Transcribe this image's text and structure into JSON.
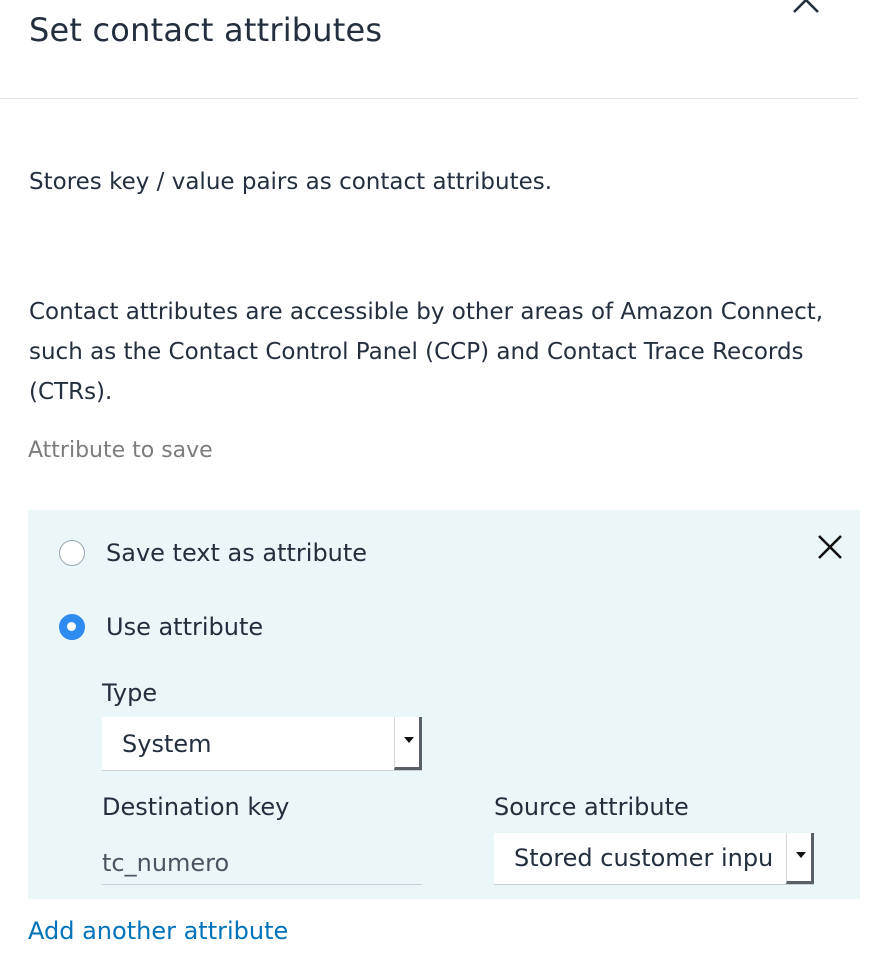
{
  "modal": {
    "title": "Set contact attributes",
    "close_icon": "close-icon"
  },
  "description": {
    "summary": "Stores key / value pairs as contact attributes.",
    "details": "Contact attributes are accessible by other areas of Amazon Connect, such as the Contact Control Panel (CCP) and Contact Trace Records (CTRs)."
  },
  "attribute_section": {
    "label": "Attribute to save",
    "remove_icon": "close-icon",
    "options": [
      {
        "label": "Save text as attribute",
        "selected": false
      },
      {
        "label": "Use attribute",
        "selected": true
      }
    ],
    "type": {
      "label": "Type",
      "value": "System"
    },
    "destination_key": {
      "label": "Destination key",
      "value": "tc_numero"
    },
    "source_attribute": {
      "label": "Source attribute",
      "value": "Stored customer input"
    }
  },
  "add_another_label": "Add another attribute",
  "colors": {
    "panel_background": "#eaf6f8",
    "radio_selected": "#2e8bf0",
    "link": "#0073bb",
    "muted_label": "#7c7c7c"
  }
}
